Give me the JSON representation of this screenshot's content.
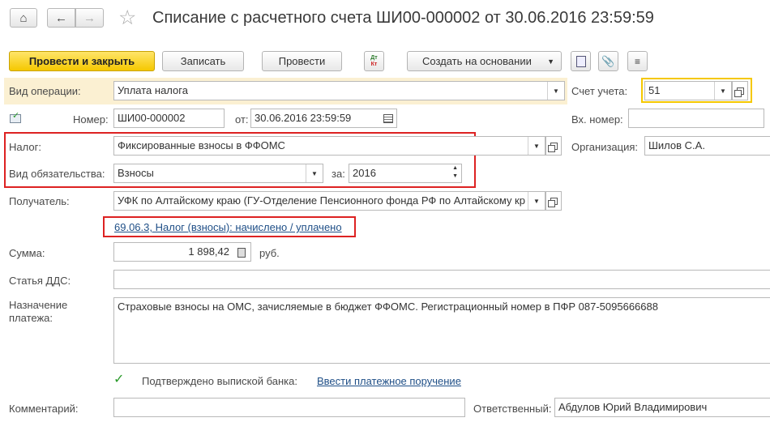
{
  "window": {
    "title": "Списание с расчетного счета ШИ00-000002 от 30.06.2016 23:59:59"
  },
  "toolbar": {
    "post_close": "Провести и закрыть",
    "save": "Записать",
    "post": "Провести",
    "create_based": "Создать на основании",
    "dtkt": "Дт Кт"
  },
  "form": {
    "operation_label": "Вид операции:",
    "operation_value": "Уплата налога",
    "account_label": "Счет учета:",
    "account_value": "51",
    "number_label": "Номер:",
    "number_value": "ШИ00-000002",
    "date_label": "от:",
    "date_value": "30.06.2016 23:59:59",
    "in_number_label": "Вх. номер:",
    "in_number_value": "",
    "tax_label": "Налог:",
    "tax_value": "Фиксированные взносы в ФФОМС",
    "org_label": "Организация:",
    "org_value": "Шилов С.А.",
    "obligation_label": "Вид обязательства:",
    "obligation_value": "Взносы",
    "period_label": "за:",
    "period_value": "2016",
    "recipient_label": "Получатель:",
    "recipient_value": "УФК по Алтайскому краю (ГУ-Отделение Пенсионного фонда РФ по Алтайскому кр",
    "account_link": "69.06.3, Налог (взносы): начислено / уплачено",
    "sum_label": "Сумма:",
    "sum_value": "1 898,42",
    "currency": "руб.",
    "dds_label": "Статья ДДС:",
    "dds_value": "",
    "purpose_label_1": "Назначение",
    "purpose_label_2": "платежа:",
    "purpose_value": "Страховые взносы на ОМС, зачисляемые в бюджет ФФОМС. Регистрационный номер в ПФР 087-5095666688",
    "confirmed_label": "Подтверждено выпиской банка:",
    "enter_order_link": "Ввести платежное поручение",
    "comment_label": "Комментарий:",
    "comment_value": "",
    "responsible_label": "Ответственный:",
    "responsible_value": "Абдулов Юрий Владимирович"
  },
  "colors": {
    "accent_yellow": "#f5c800",
    "highlight_row": "#fbf0d2",
    "red_box": "#dd2222",
    "link": "#1f4f87"
  }
}
